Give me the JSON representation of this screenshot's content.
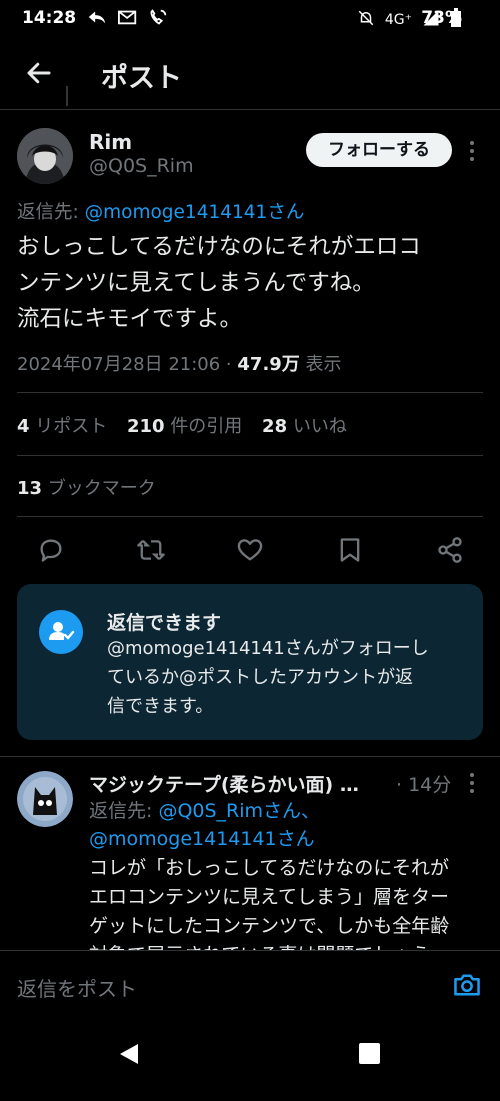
{
  "status_bar": {
    "time": "14:28",
    "network": "4G⁺",
    "battery": "73%"
  },
  "header": {
    "title": "ポスト"
  },
  "tweet": {
    "name": "Rim",
    "handle": "@Q0S_Rim",
    "follow_label": "フォローする",
    "reply_to_prefix": "返信先: ",
    "reply_to_user": "@momoge1414141さん",
    "text_line1": "おしっこしてるだけなのにそれがエロコ",
    "text_line2": "ンテンツに見えてしまうんですね。",
    "text_line3": "流石にキモイですよ。",
    "date": "2024年07月28日 21:06 · ",
    "views_count": "47.9万",
    "views_label": " 表示",
    "reposts_count": "4",
    "reposts_label": "リポスト",
    "quotes_count": "210",
    "quotes_label": "件の引用",
    "likes_count": "28",
    "likes_label": "いいね",
    "bookmarks_count": "13",
    "bookmarks_label": "ブックマーク"
  },
  "reply_card": {
    "title": "返信できます",
    "line1": "@momoge1414141さんがフォローし",
    "line2": "ているか@ポストしたアカウントが返",
    "line3": "信できます。"
  },
  "reply": {
    "name": "マジックテープ(柔らかい面) …",
    "time": "· 14分",
    "reply_to_prefix": "返信先: ",
    "reply_to_user1": "@Q0S_Rimさん、",
    "reply_to_user2": "@momoge1414141さん",
    "text_line1": "コレが「おしっこしてるだけなのにそれが",
    "text_line2": "エロコンテンツに見えてしまう」層をター",
    "text_line3": "ゲットにしたコンテンツで、しかも全年齢",
    "text_line4": "対象で展示されている事は問題でしょう"
  },
  "composer": {
    "placeholder": "返信をポスト"
  },
  "colors": {
    "accent": "#1d9bf0",
    "background": "#000000",
    "card": "#0c2633"
  }
}
